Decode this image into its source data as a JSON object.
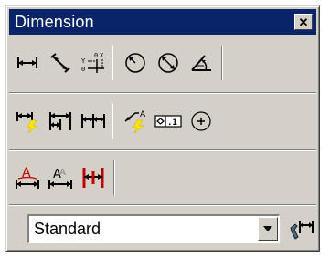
{
  "window": {
    "title": "Dimension",
    "close_glyph": "✕"
  },
  "toolbar": {
    "row1": [
      {
        "name": "linear-dimension-icon"
      },
      {
        "name": "aligned-dimension-icon"
      },
      {
        "name": "ordinate-dimension-icon"
      },
      {
        "name": "radius-dimension-icon"
      },
      {
        "name": "diameter-dimension-icon"
      },
      {
        "name": "angular-dimension-icon"
      }
    ],
    "row2": [
      {
        "name": "quick-dimension-icon"
      },
      {
        "name": "baseline-dimension-icon"
      },
      {
        "name": "continue-dimension-icon"
      },
      {
        "name": "quick-leader-icon"
      },
      {
        "name": "tolerance-icon",
        "label": "⌀.1"
      },
      {
        "name": "center-mark-icon"
      }
    ],
    "row3": [
      {
        "name": "dimension-edit-icon",
        "label": "A"
      },
      {
        "name": "dimension-text-edit-icon",
        "label": "A"
      },
      {
        "name": "dimension-update-icon"
      }
    ]
  },
  "dimstyle": {
    "value": "Standard"
  },
  "colors": {
    "titlebar": "#0a246a",
    "face": "#d4d0c8",
    "accent_yellow": "#ffe600",
    "accent_red": "#c00000"
  }
}
